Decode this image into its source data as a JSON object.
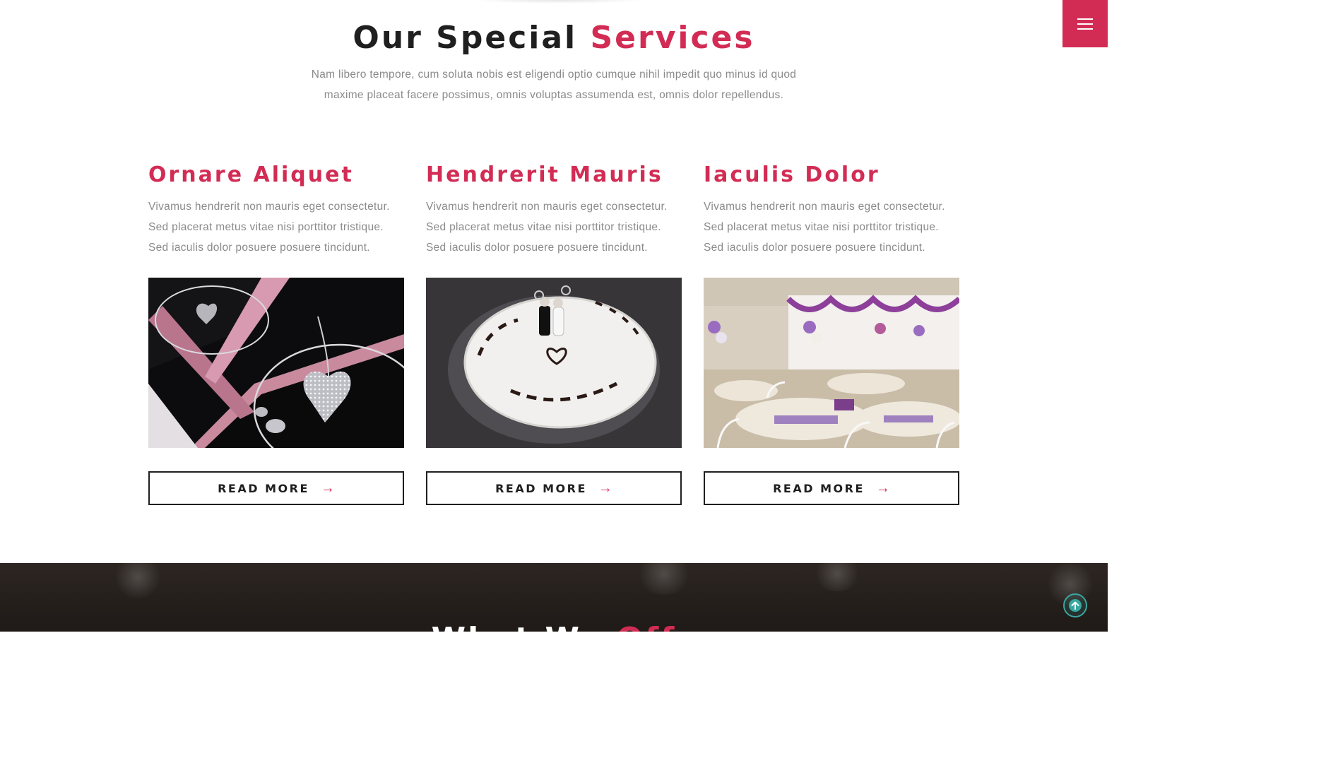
{
  "header": {
    "title_main": "Our Special",
    "title_accent": "Services",
    "description_line1": "Nam libero tempore, cum soluta nobis est eligendi optio cumque nihil impedit quo minus id quod",
    "description_line2": "maxime placeat facere possimus, omnis voluptas assumenda est, omnis dolor repellendus."
  },
  "services": [
    {
      "title": "Ornare Aliquet",
      "lines": [
        "Vivamus hendrerit non mauris eget consectetur.",
        "Sed placerat metus vitae nisi porttitor tristique.",
        "Sed iaculis dolor posuere posuere tincidunt."
      ],
      "image_subject": "jewelry heart necklace in pink box",
      "button_label": "READ MORE"
    },
    {
      "title": "Hendrerit Mauris",
      "lines": [
        "Vivamus hendrerit non mauris eget consectetur.",
        "Sed placerat metus vitae nisi porttitor tristique.",
        "Sed iaculis dolor posuere posuere tincidunt."
      ],
      "image_subject": "white wedding cake with bride and groom topper",
      "button_label": "READ MORE"
    },
    {
      "title": "Iaculis Dolor",
      "lines": [
        "Vivamus hendrerit non mauris eget consectetur.",
        "Sed placerat metus vitae nisi porttitor tristique.",
        "Sed iaculis dolor posuere posuere tincidunt."
      ],
      "image_subject": "banquet hall decorated with purple balloons and tables",
      "button_label": "READ MORE"
    }
  ],
  "next_section": {
    "title_main": "What We",
    "title_accent": "Off"
  },
  "icons": {
    "menu": "hamburger-icon",
    "button_arrow": "arrow-right-icon",
    "scroll_top": "arrow-up-circle-icon"
  },
  "colors": {
    "accent": "#d22c54",
    "text_dark": "#1f1f1f",
    "text_muted": "#8a8a8a",
    "scroll_top": "#3aa6a0"
  }
}
